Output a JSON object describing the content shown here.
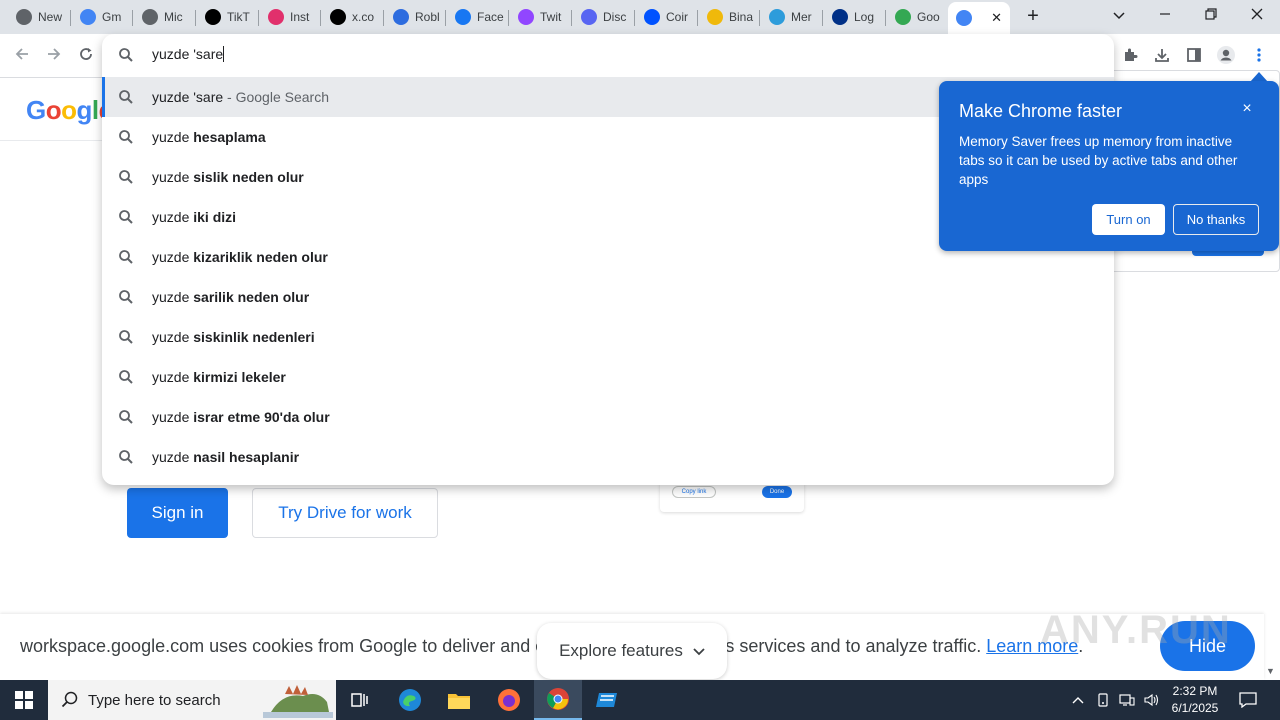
{
  "browser": {
    "tabs": [
      {
        "label": "New",
        "icon": "chrome-icon",
        "color": "#5f6368"
      },
      {
        "label": "Gm",
        "icon": "google-icon",
        "color": "#4285f4"
      },
      {
        "label": "Mic",
        "icon": "globe-icon",
        "color": "#5f6368"
      },
      {
        "label": "TikT",
        "icon": "tiktok-icon",
        "color": "#000000"
      },
      {
        "label": "Inst",
        "icon": "instagram-icon",
        "color": "#e1306c"
      },
      {
        "label": "x.co",
        "icon": "x-icon",
        "color": "#000000"
      },
      {
        "label": "Robl",
        "icon": "roblox-icon",
        "color": "#2d6cdf"
      },
      {
        "label": "Face",
        "icon": "facebook-icon",
        "color": "#1877f2"
      },
      {
        "label": "Twit",
        "icon": "twitch-icon",
        "color": "#9146ff"
      },
      {
        "label": "Disc",
        "icon": "discord-icon",
        "color": "#5865f2"
      },
      {
        "label": "Coir",
        "icon": "coinbase-icon",
        "color": "#0052ff"
      },
      {
        "label": "Bina",
        "icon": "binance-icon",
        "color": "#f0b90b"
      },
      {
        "label": "Mer",
        "icon": "mercado-icon",
        "color": "#2d9cdb"
      },
      {
        "label": "Log",
        "icon": "paypal-icon",
        "color": "#003087"
      },
      {
        "label": "Goo",
        "icon": "google-photos-icon",
        "color": "#34a853"
      },
      {
        "label": "",
        "icon": "google-icon",
        "color": "#4285f4"
      }
    ]
  },
  "omnibox": {
    "input": "yuzde 'sare",
    "suggestions": [
      {
        "prefix": "yuzde 'sare",
        "bold": "",
        "suffix": " - Google Search"
      },
      {
        "prefix": "yuzde ",
        "bold": "hesaplama",
        "suffix": ""
      },
      {
        "prefix": "yuzde ",
        "bold": "sislik neden olur",
        "suffix": ""
      },
      {
        "prefix": "yuzde ",
        "bold": "iki dizi",
        "suffix": ""
      },
      {
        "prefix": "yuzde ",
        "bold": "kizariklik neden olur",
        "suffix": ""
      },
      {
        "prefix": "yuzde ",
        "bold": "sarilik neden olur",
        "suffix": ""
      },
      {
        "prefix": "yuzde ",
        "bold": "siskinlik nedenleri",
        "suffix": ""
      },
      {
        "prefix": "yuzde ",
        "bold": "kirmizi lekeler",
        "suffix": ""
      },
      {
        "prefix": "yuzde ",
        "bold": "israr etme 90'da olur",
        "suffix": ""
      },
      {
        "prefix": "yuzde ",
        "bold": "nasil hesaplanir",
        "suffix": ""
      }
    ]
  },
  "bubble": {
    "title": "Make Chrome faster",
    "body": "Memory Saver frees up memory from inactive tabs so it can be used by active tabs and other apps",
    "turn_on": "Turn on",
    "no_thanks": "No thanks",
    "close": "×"
  },
  "page": {
    "logo": "Google",
    "sign_in": "Sign in",
    "try_drive": "Try Drive for work",
    "mock_copy": "Copy link",
    "mock_done": "Done",
    "cookie_text": "workspace.google.com uses cookies from Google to deliver and enhance the quality of its services and to analyze traffic.",
    "learn_more": "Learn more",
    "cookie_period": ".",
    "hide": "Hide",
    "explore": "Explore features",
    "watermark": "ANY.RUN"
  },
  "taskbar": {
    "search_placeholder": "Type here to search",
    "time": "2:32 PM",
    "date": "6/1/2025"
  },
  "colors": {
    "accent": "#1a73e8",
    "bubble": "#1967d2",
    "taskbar": "#202c3c"
  }
}
